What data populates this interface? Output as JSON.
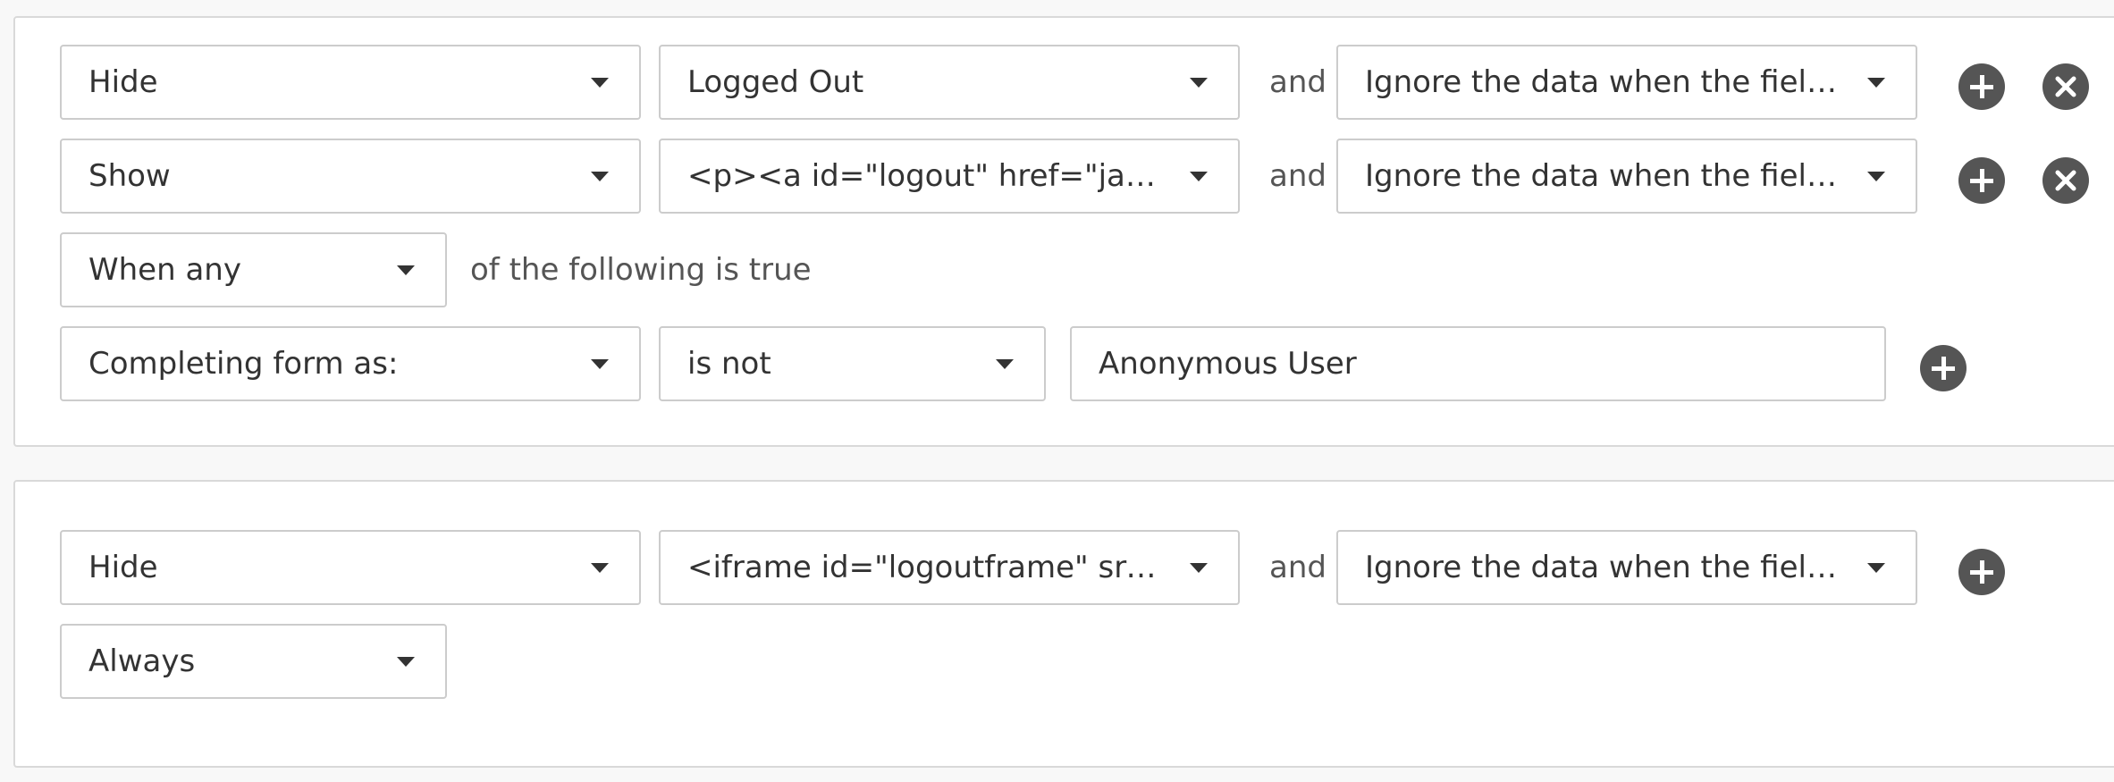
{
  "colors": {
    "page_background": "#f8f8f8",
    "panel_border": "#d9d9d9",
    "field_border": "#cccccc",
    "icon": "#555555",
    "text": "#333333",
    "muted_text": "#555555"
  },
  "rule_group_1": {
    "actions": [
      {
        "action": "Hide",
        "target": "Logged Out",
        "connector": "and",
        "data_handling": "Ignore the data when the field/s…",
        "add_icon": "plus-circle-icon",
        "remove_icon": "x-circle-icon"
      },
      {
        "action": "Show",
        "target": "<p><a id=\"logout\" href=\"javascri…",
        "connector": "and",
        "data_handling": "Ignore the data when the field/s…",
        "add_icon": "plus-circle-icon",
        "remove_icon": "x-circle-icon"
      }
    ],
    "condition_match": "When any",
    "condition_suffix": "of the following is true",
    "conditions": [
      {
        "field": "Completing form as:",
        "operator": "is not",
        "value": "Anonymous User",
        "add_icon": "plus-circle-icon"
      }
    ]
  },
  "rule_group_2": {
    "actions": [
      {
        "action": "Hide",
        "target": "<iframe id=\"logoutframe\" src=\"a…",
        "connector": "and",
        "data_handling": "Ignore the data when the field/s…",
        "add_icon": "plus-circle-icon"
      }
    ],
    "condition_match": "Always"
  }
}
